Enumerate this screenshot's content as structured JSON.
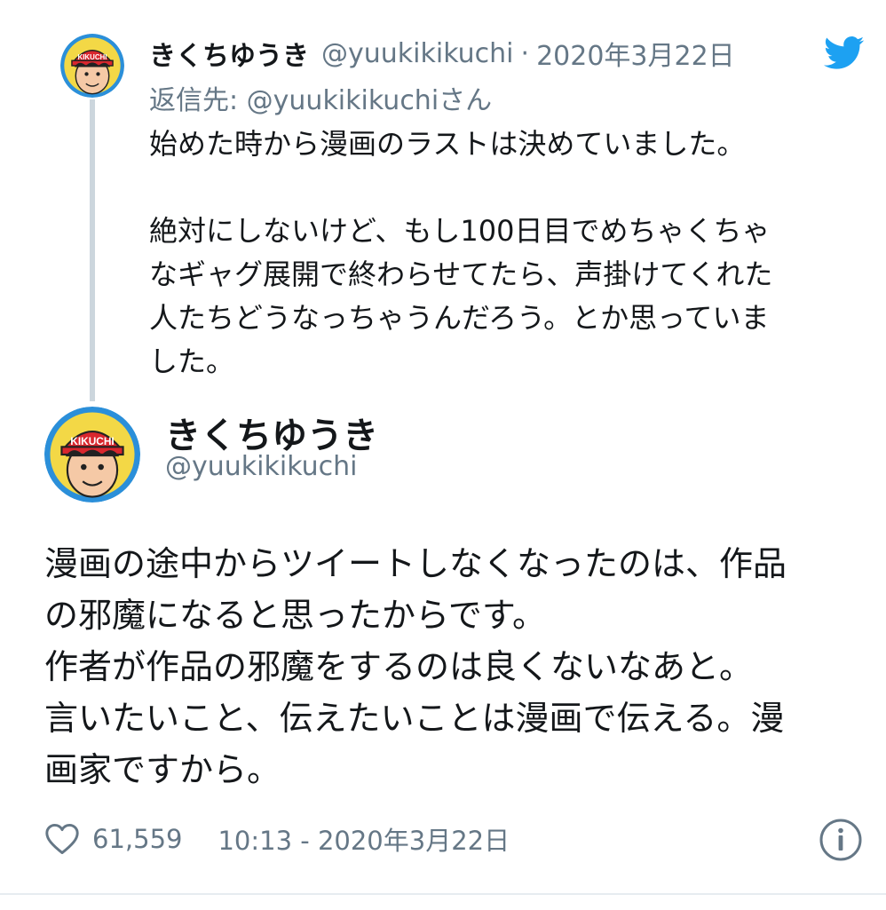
{
  "reply_tweet": {
    "display_name": "きくちゆうき",
    "handle": "@yuukikikuchi",
    "separator": "·",
    "date": "2020年3月22日",
    "reply_to_prefix": "返信先: ",
    "reply_to_handle": "@yuukikikuchi",
    "reply_to_suffix": "さん",
    "text": "始めた時から漫画のラストは決めていました。\n\n絶対にしないけど、もし100日目でめちゃくちゃ\nなギャグ展開で終わらせてたら、声掛けてくれた\n人たちどうなっちゃうんだろう。とか思っていま\nした。"
  },
  "main_tweet": {
    "display_name": "きくちゆうき",
    "handle": "@yuukikikuchi",
    "text": "漫画の途中からツイートしなくなったのは、作品\nの邪魔になると思ったからです。\n作者が作品の邪魔をするのは良くないなあと。\n言いたいこと、伝えたいことは漫画で伝える。漫\n画家ですから。",
    "like_count": "61,559",
    "timestamp": "10:13 - 2020年3月22日"
  },
  "avatar": {
    "cap_text": "KIKUCHI"
  },
  "icons": {
    "brand": "twitter-bird-icon",
    "like": "heart-icon",
    "info": "info-icon"
  },
  "colors": {
    "twitter_blue": "#1da1f2",
    "secondary_text": "#657786",
    "primary_text": "#14171a",
    "thread_line": "#ccd6dd"
  }
}
